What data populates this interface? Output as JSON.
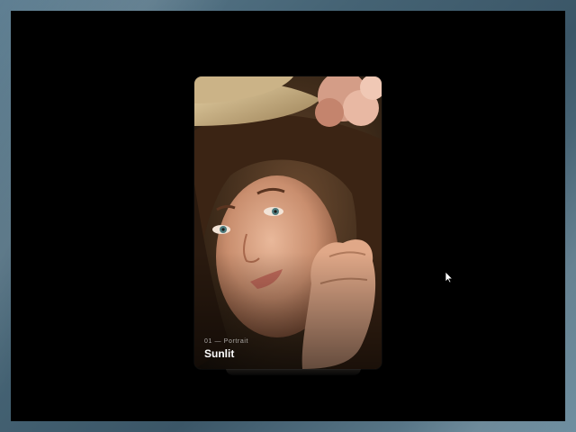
{
  "card": {
    "kicker": "01 — Portrait",
    "title": "Sunlit"
  },
  "theme": {
    "stage_bg": "#000000",
    "frame_color": "#456374",
    "caption_text": "#ffffff"
  },
  "icons": {
    "cursor": "mouse-pointer-icon"
  }
}
